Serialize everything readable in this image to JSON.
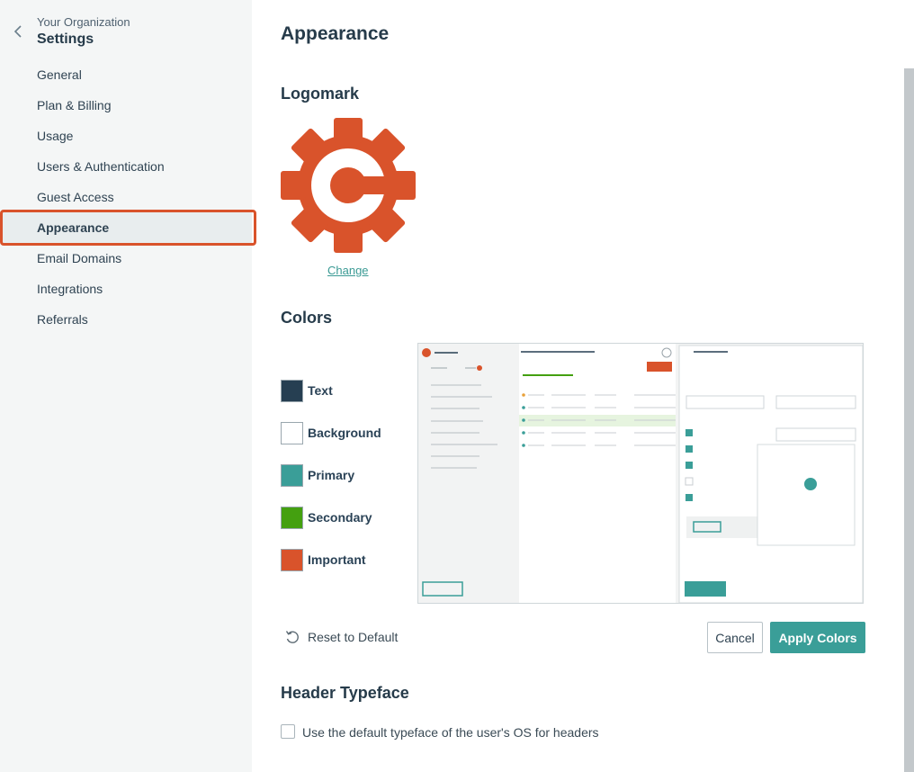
{
  "sidebar": {
    "org_name": "Your Organization",
    "title": "Settings",
    "items": [
      {
        "label": "General"
      },
      {
        "label": "Plan & Billing"
      },
      {
        "label": "Usage"
      },
      {
        "label": "Users & Authentication"
      },
      {
        "label": "Guest Access"
      },
      {
        "label": "Appearance",
        "active": true
      },
      {
        "label": "Email Domains"
      },
      {
        "label": "Integrations"
      },
      {
        "label": "Referrals"
      }
    ]
  },
  "main": {
    "title": "Appearance",
    "logomark": {
      "heading": "Logomark",
      "change_label": "Change",
      "icon": "gear-c-logo-icon",
      "color": "#d9532b"
    },
    "colors": {
      "heading": "Colors",
      "swatches": [
        {
          "label": "Text",
          "color": "#263f52"
        },
        {
          "label": "Background",
          "color": "#ffffff"
        },
        {
          "label": "Primary",
          "color": "#3a9e98"
        },
        {
          "label": "Secondary",
          "color": "#44a010"
        },
        {
          "label": "Important",
          "color": "#d9532b"
        }
      ],
      "reset_label": "Reset to Default",
      "cancel_label": "Cancel",
      "apply_label": "Apply Colors"
    },
    "header_typeface": {
      "heading": "Header Typeface",
      "checkbox_label": "Use the default typeface of the user's OS for headers",
      "checked": false
    }
  }
}
